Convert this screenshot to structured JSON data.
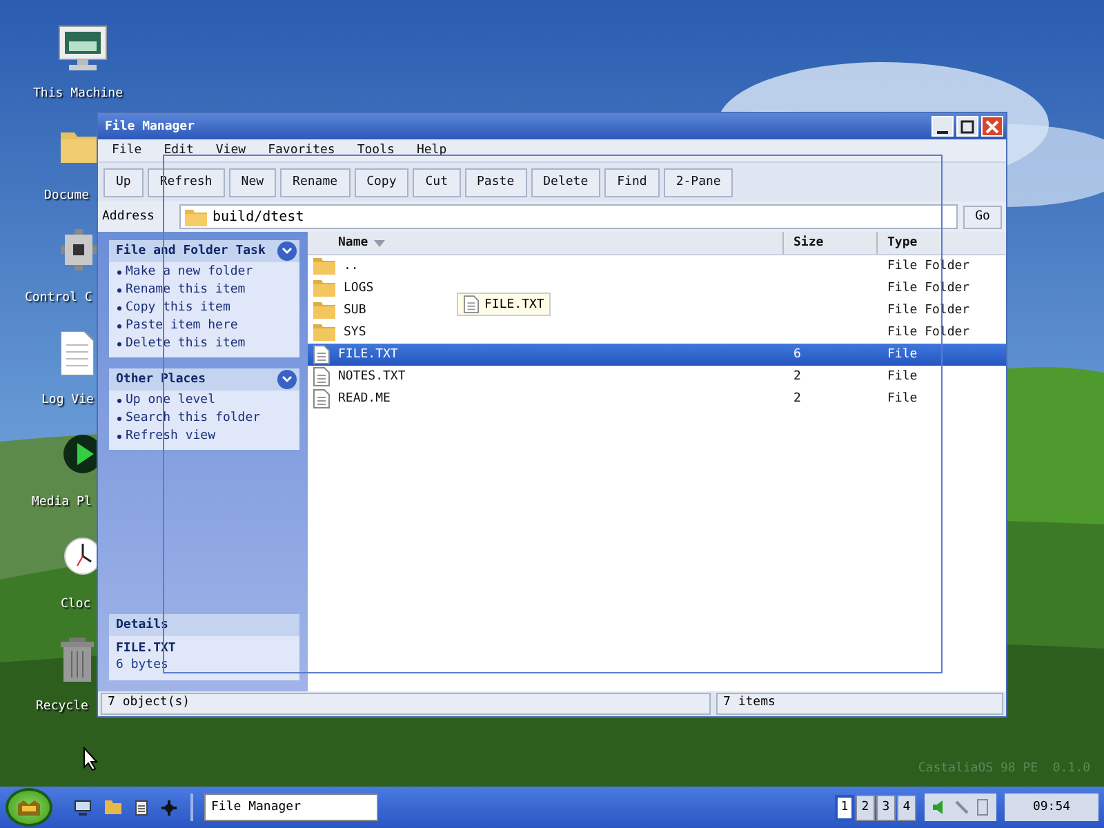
{
  "desktop": {
    "icons": [
      {
        "label": "This Machine",
        "kind": "monitor"
      },
      {
        "label": "Docume",
        "kind": "folder"
      },
      {
        "label": "Control C",
        "kind": "gear"
      },
      {
        "label": "Log Vie",
        "kind": "document"
      },
      {
        "label": "Media Pl",
        "kind": "play"
      },
      {
        "label": "Cloc",
        "kind": "clock"
      },
      {
        "label": "Recycle",
        "kind": "trash"
      }
    ],
    "version": "CastaliaOS 98 PE  0.1.0"
  },
  "window": {
    "title": "File Manager",
    "menu": [
      "File",
      "Edit",
      "View",
      "Favorites",
      "Tools",
      "Help"
    ],
    "toolbar": [
      "Up",
      "Refresh",
      "New",
      "Rename",
      "Copy",
      "Cut",
      "Paste",
      "Delete",
      "Find",
      "2-Pane"
    ],
    "address": {
      "label": "Address",
      "value": "build/dtest",
      "go": "Go"
    },
    "panels": [
      {
        "title": "File and Folder Task",
        "expanded": true,
        "items": [
          "Make a new folder",
          "Rename this item",
          "Copy this item",
          "Paste item here",
          "Delete this item"
        ]
      },
      {
        "title": "Other Places",
        "expanded": true,
        "items": [
          "Up one level",
          "Search this folder",
          "Refresh view"
        ]
      }
    ],
    "details": {
      "title": "Details",
      "name": "FILE.TXT",
      "info": "6 bytes"
    },
    "columns": [
      {
        "label": "Name",
        "sorted": true
      },
      {
        "label": "Size",
        "sorted": false
      },
      {
        "label": "Type",
        "sorted": false
      }
    ],
    "files": [
      {
        "name": "..",
        "type": "File Folder",
        "kind": "folder",
        "selected": false
      },
      {
        "name": "LOGS",
        "type": "File Folder",
        "kind": "folder",
        "selected": false
      },
      {
        "name": "SUB",
        "type": "File Folder",
        "kind": "folder",
        "selected": false
      },
      {
        "name": "SYS",
        "type": "File Folder",
        "kind": "folder",
        "selected": false
      },
      {
        "name": "FILE.TXT",
        "size": "6",
        "type": "File",
        "kind": "file",
        "selected": true
      },
      {
        "name": "NOTES.TXT",
        "size": "2",
        "type": "File",
        "kind": "file",
        "selected": false
      },
      {
        "name": "READ.ME",
        "size": "2",
        "type": "File",
        "kind": "file",
        "selected": false
      }
    ],
    "drag_ghost": "FILE.TXT",
    "status": [
      "7 object(s)",
      "7 items"
    ]
  },
  "taskbar": {
    "task": "File Manager",
    "workspaces": [
      {
        "label": "1",
        "selected": true
      },
      {
        "label": "2",
        "selected": false
      },
      {
        "label": "3",
        "selected": false
      },
      {
        "label": "4",
        "selected": false
      }
    ],
    "clock": "09:54"
  }
}
